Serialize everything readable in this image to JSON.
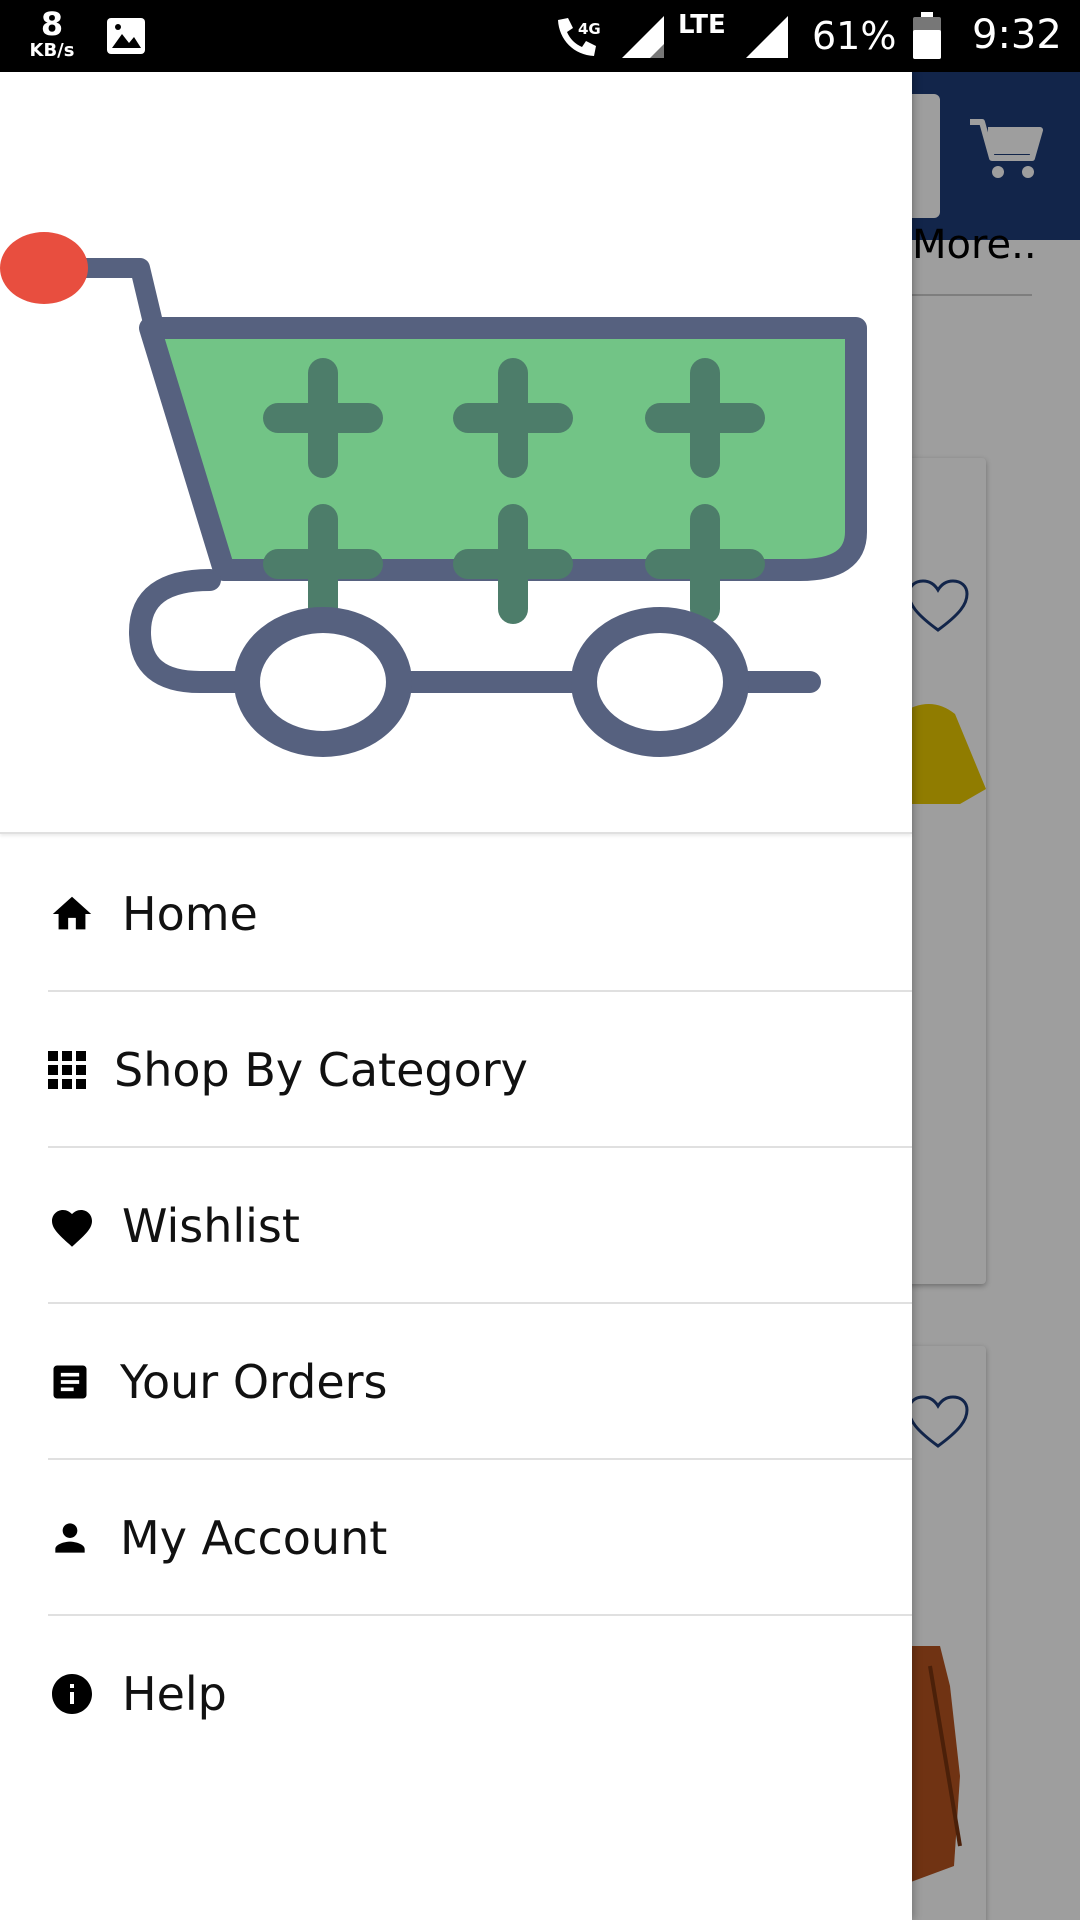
{
  "status_bar": {
    "speed_value": "8",
    "speed_unit": "KB/s",
    "network": "LTE",
    "call_network": "4G",
    "battery_percent": "61%",
    "time": "9:32"
  },
  "background": {
    "more_text": "More.."
  },
  "drawer": {
    "logo": "shopping-cart-logo",
    "menu": [
      {
        "id": "home",
        "label": "Home",
        "icon": "home-icon"
      },
      {
        "id": "shop-by-category",
        "label": "Shop By Category",
        "icon": "grid-icon"
      },
      {
        "id": "wishlist",
        "label": "Wishlist",
        "icon": "heart-icon"
      },
      {
        "id": "your-orders",
        "label": "Your Orders",
        "icon": "orders-icon"
      },
      {
        "id": "my-account",
        "label": "My Account",
        "icon": "person-icon"
      },
      {
        "id": "help",
        "label": "Help",
        "icon": "info-icon"
      }
    ]
  },
  "colors": {
    "header_blue": "#1e3c78",
    "cart_green": "#72c486",
    "cart_frame": "#56617f",
    "cart_plus": "#4d7d6a",
    "handle_red": "#e84e3f"
  }
}
